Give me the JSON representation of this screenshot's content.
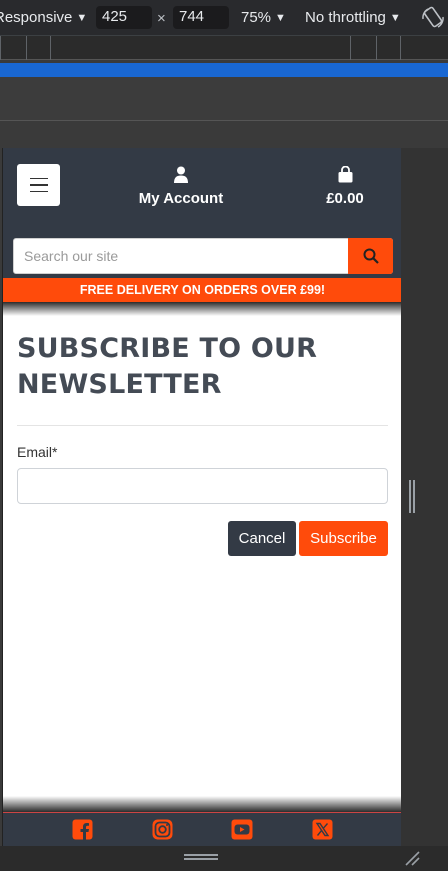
{
  "devtools": {
    "device": "Responsive",
    "width": "425",
    "times": "×",
    "height": "744",
    "zoom": "75%",
    "throttling": "No throttling"
  },
  "header": {
    "account_label": "My Account",
    "cart_label": "£0.00"
  },
  "search": {
    "placeholder": "Search our site"
  },
  "promo": {
    "text": "FREE DELIVERY ON ORDERS OVER £99!"
  },
  "form": {
    "title": "SUBSCRIBE TO OUR NEWSLETTER",
    "email_label": "Email*",
    "cancel_label": "Cancel",
    "subscribe_label": "Subscribe"
  },
  "footer": {
    "social": [
      "facebook-icon",
      "instagram-icon",
      "youtube-icon",
      "x-icon"
    ]
  },
  "colors": {
    "accent": "#ff4b0b",
    "header_bg": "#333a45",
    "devtools_blue": "#1967d2"
  }
}
